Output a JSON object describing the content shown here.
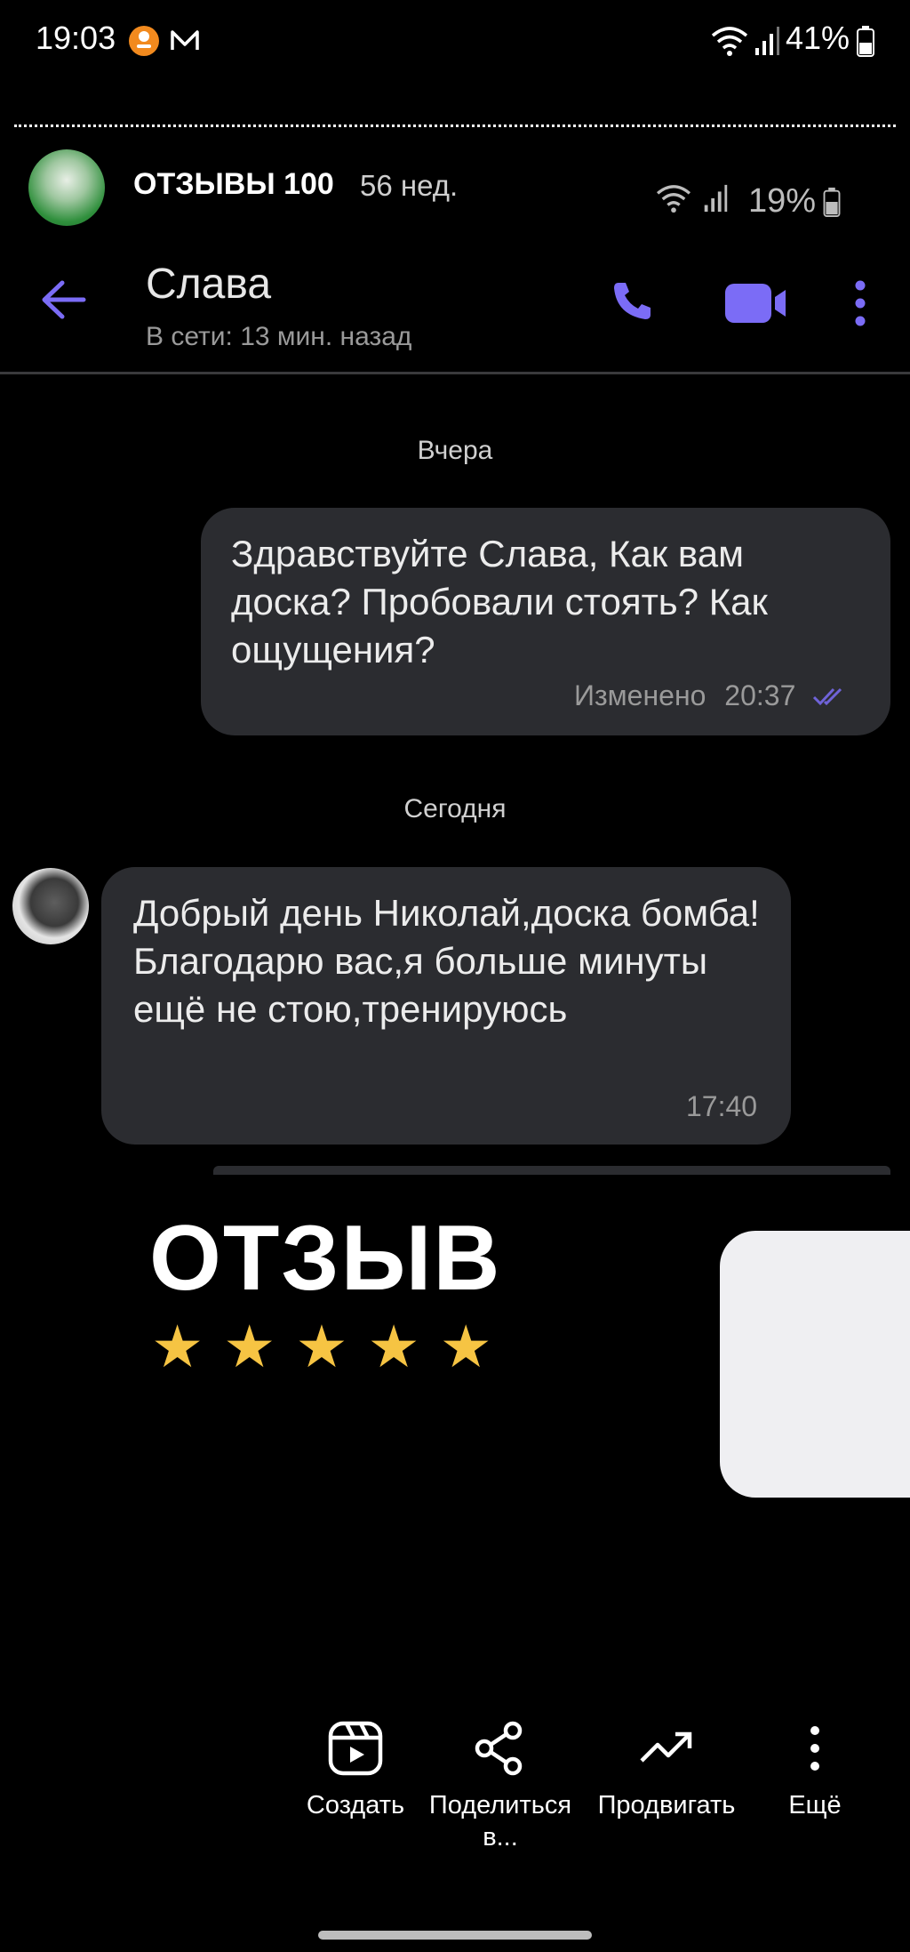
{
  "status_bar": {
    "time": "19:03",
    "battery": "41%",
    "icons": [
      "ok-app-icon",
      "mail-icon",
      "wifi-icon",
      "signal-icon",
      "battery-icon"
    ]
  },
  "story": {
    "title": "ОТЗЫВЫ 100",
    "age": "56 нед."
  },
  "screenshot": {
    "battery": "19%",
    "chat": {
      "name": "Слава",
      "status": "В сети: 13 мин. назад",
      "date_yesterday": "Вчера",
      "date_today": "Сегодня",
      "outgoing": {
        "text": "Здравствуйте Слава, Как вам доска? Пробовали стоять? Как ощущения?",
        "edited": "Изменено",
        "time": "20:37"
      },
      "incoming": {
        "text": "Добрый день Николай,доска бомба!Благодарю вас,я больше минуты ещё не стою,тренируюсь",
        "time": "17:40"
      }
    }
  },
  "overlay": {
    "title": "ОТЗЫВ",
    "stars": "★★★★★",
    "rating": 5
  },
  "actions": {
    "create": "Создать",
    "share": "Поделиться в...",
    "promote": "Продвигать",
    "more": "Ещё"
  },
  "colors": {
    "accent": "#7b6cf6",
    "bubble": "#2b2c30",
    "star": "#f6c443"
  }
}
